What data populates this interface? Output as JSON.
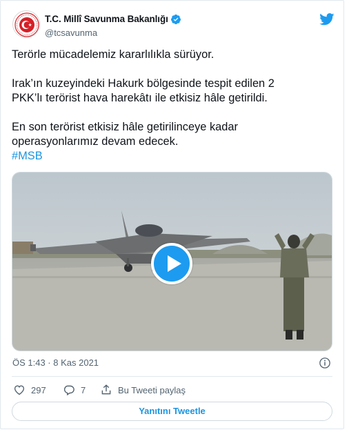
{
  "account": {
    "name": "T.C. Millî Savunma Bakanlığı",
    "handle": "@tcsavunma",
    "verified": true,
    "avatar_icon": "msb-emblem-icon"
  },
  "tweet": {
    "line1": "Terörle mücadelemiz kararlılıkla sürüyor.",
    "line2a": "Irak’ın kuzeyindeki Hakurk bölgesinde tespit edilen 2",
    "line2b": "PKK’lı terörist hava harekâtı ile etkisiz hâle getirildi.",
    "line3a": "En son terörist etkisiz hâle getirilinceye kadar",
    "line3b": "operasyonlarımız devam edecek.",
    "hashtag": "#MSB"
  },
  "media": {
    "type": "video",
    "play_icon": "play-icon"
  },
  "meta": {
    "timestamp": "ÖS 1:43 · 8 Kas 2021"
  },
  "actions": {
    "likes": "297",
    "replies": "7",
    "share_label": "Bu Tweeti paylaş"
  },
  "reply_button": "Yanıtını Tweetle",
  "colors": {
    "accent": "#1d9bf0",
    "link": "#1b95e0",
    "text": "#0f1419",
    "muted": "#536471",
    "emblem_red": "#d61f26"
  }
}
